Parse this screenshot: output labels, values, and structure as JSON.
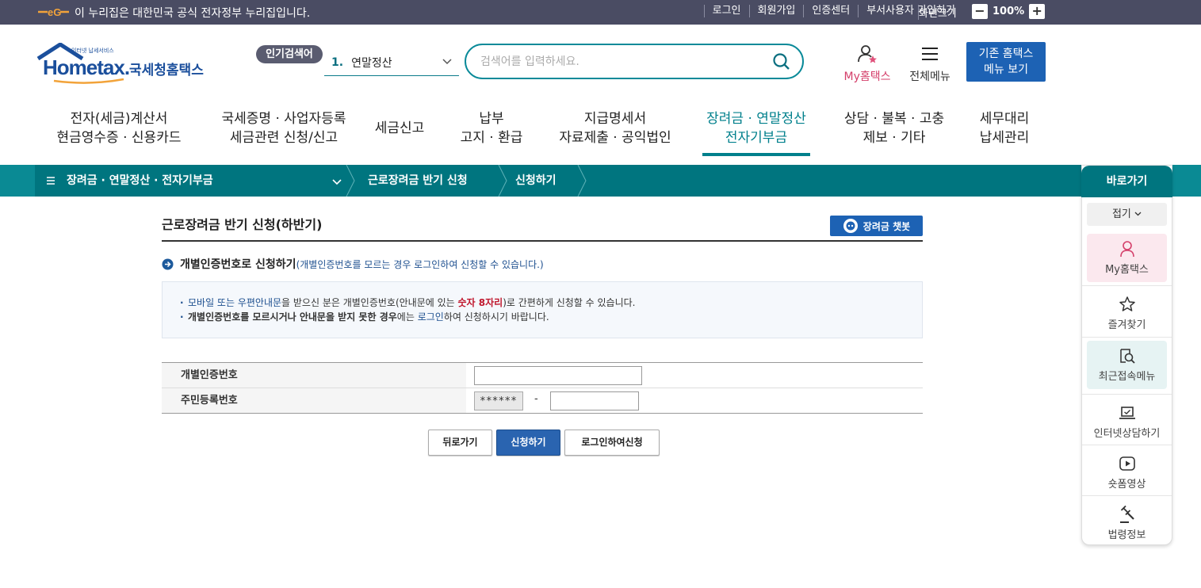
{
  "govbar": {
    "text": "이 누리집은 대한민국 공식 전자정부 누리집입니다.",
    "links": [
      "로그인",
      "회원가입",
      "인증센터",
      "부서사용자 가입하기"
    ],
    "screen_size_label": "화면크기",
    "zoom_minus": "−",
    "zoom_level": "100%",
    "zoom_plus": "+"
  },
  "header": {
    "logo_small": "인터넷 납세서비스",
    "logo_main": "Hometax.",
    "logo_kr": "국세청홈택스",
    "popular_tag": "인기검색어",
    "popular_num": "1.",
    "popular_term": "연말정산",
    "search_placeholder": "검색어를 입력하세요.",
    "my_hometax": "My홈택스",
    "all_menu": "전체메뉴",
    "old_hometax_line1": "기존 홈택스",
    "old_hometax_line2": "메뉴 보기"
  },
  "gnb": [
    {
      "line1": "전자(세금)계산서",
      "line2": "현금영수증 · 신용카드"
    },
    {
      "line1": "국세증명 · 사업자등록",
      "line2": "세금관련 신청/신고"
    },
    {
      "line1": "세금신고",
      "line2": ""
    },
    {
      "line1": "납부",
      "line2": "고지 · 환급"
    },
    {
      "line1": "지급명세서",
      "line2": "자료제출 · 공익법인"
    },
    {
      "line1": "장려금 · 연말정산",
      "line2": "전자기부금"
    },
    {
      "line1": "상담 · 불복 · 고충",
      "line2": "제보 · 기타"
    },
    {
      "line1": "세무대리",
      "line2": "납세관리"
    }
  ],
  "breadcrumb": {
    "menu": "장려금 · 연말정산 · 전자기부금",
    "level2": "근로장려금 반기 신청",
    "level3": "신청하기"
  },
  "main": {
    "title": "근로장려금 반기 신청(하반기)",
    "chatbot": "장려금 챗봇",
    "subhead_bold": "개별인증번호로 신청하기",
    "subhead_note": "(개별인증번호를 모르는 경우 로그인하여 신청할 수 있습니다.)",
    "info1_a": "모바일 또는 우편안내문",
    "info1_b": "을 받으신 분은 개별인증번호(안내문에 있는 ",
    "info1_c": "숫자 8자리",
    "info1_d": ")로 간편하게 신청할 수 있습니다.",
    "info2_a": "개별인증번호를 모르시거나 안내문을 받지 못한 경우",
    "info2_b": "에는 ",
    "info2_c": "로그인",
    "info2_d": "하여 신청하시기 바랍니다.",
    "field1_label": "개별인증번호",
    "field1_value": "",
    "field2_label": "주민등록번호",
    "field2_front": "******",
    "field2_dash": "-",
    "field2_back": "",
    "btn_back": "뒤로가기",
    "btn_apply": "신청하기",
    "btn_login_apply": "로그인하여신청"
  },
  "quick": {
    "title": "바로가기",
    "fold": "접기",
    "items": [
      "My홈택스",
      "즐겨찾기",
      "최근접속메뉴",
      "인터넷상담하기",
      "숏폼영상",
      "법령정보"
    ]
  },
  "colors": {
    "teal": "#00808c",
    "navy_bar": "#4a4c63",
    "primary_blue": "#2a64b0",
    "pink": "#d43f6a"
  }
}
